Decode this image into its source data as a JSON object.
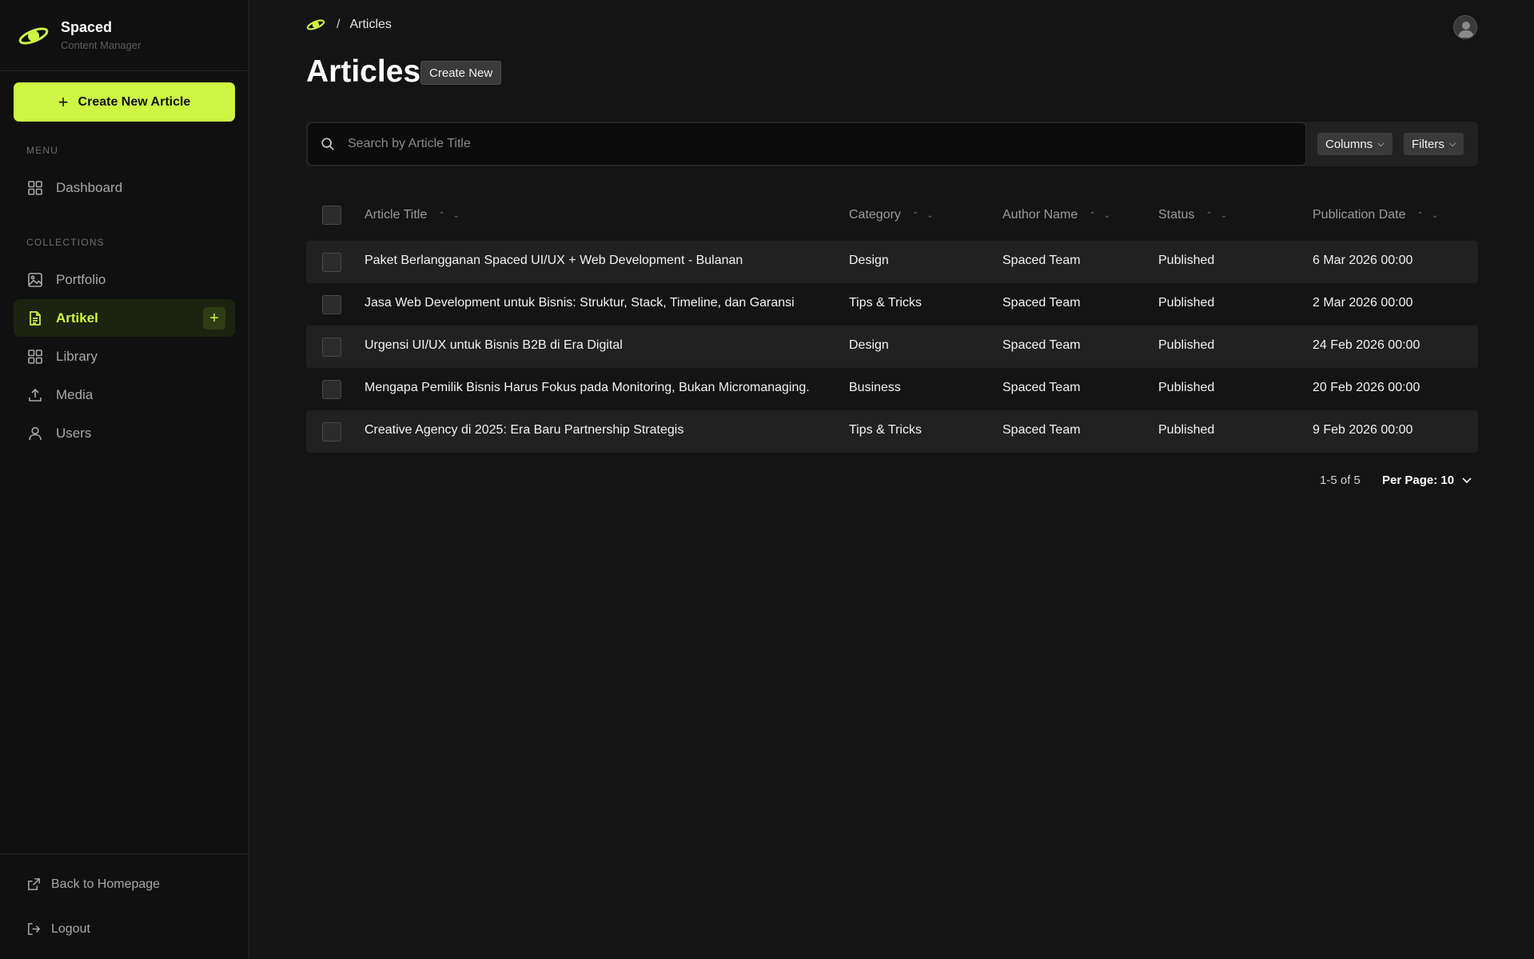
{
  "brand": {
    "name": "Spaced",
    "subtitle": "Content Manager"
  },
  "sidebar": {
    "create_label": "Create New Article",
    "menu_label": "MENU",
    "collections_label": "COLLECTIONS",
    "items": [
      {
        "label": "Dashboard",
        "icon": "grid-icon"
      },
      {
        "label": "Portfolio",
        "icon": "image-icon"
      },
      {
        "label": "Artikel",
        "icon": "document-icon",
        "active": true
      },
      {
        "label": "Library",
        "icon": "grid-icon"
      },
      {
        "label": "Media",
        "icon": "upload-icon"
      },
      {
        "label": "Users",
        "icon": "user-icon"
      }
    ],
    "footer": {
      "back_label": "Back to Homepage",
      "logout_label": "Logout"
    }
  },
  "header": {
    "breadcrumb_current": "Articles",
    "breadcrumb_sep": "/"
  },
  "main": {
    "title": "Articles",
    "create_new_label": "Create New",
    "search_placeholder": "Search by Article Title",
    "columns_label": "Columns",
    "filters_label": "Filters"
  },
  "table": {
    "columns": [
      "Article Title",
      "Category",
      "Author Name",
      "Status",
      "Publication Date"
    ],
    "rows": [
      {
        "title": "Paket Berlangganan Spaced UI/UX + Web Development - Bulanan",
        "category": "Design",
        "author": "Spaced Team",
        "status": "Published",
        "date": "6 Mar 2026 00:00"
      },
      {
        "title": "Jasa Web Development untuk Bisnis: Struktur, Stack, Timeline, dan Garansi",
        "category": "Tips & Tricks",
        "author": "Spaced Team",
        "status": "Published",
        "date": "2 Mar 2026 00:00"
      },
      {
        "title": "Urgensi UI/UX untuk Bisnis B2B di Era Digital",
        "category": "Design",
        "author": "Spaced Team",
        "status": "Published",
        "date": "24 Feb 2026 00:00"
      },
      {
        "title": "Mengapa Pemilik Bisnis Harus Fokus pada Monitoring, Bukan Micromanaging.",
        "category": "Business",
        "author": "Spaced Team",
        "status": "Published",
        "date": "20 Feb 2026 00:00"
      },
      {
        "title": "Creative Agency di 2025: Era Baru Partnership Strategis",
        "category": "Tips & Tricks",
        "author": "Spaced Team",
        "status": "Published",
        "date": "9 Feb 2026 00:00"
      }
    ]
  },
  "pagination": {
    "range": "1-5 of 5",
    "per_page": "Per Page: 10"
  },
  "colors": {
    "accent": "#cdf542",
    "background": "#141414",
    "sidebar": "#101010"
  }
}
